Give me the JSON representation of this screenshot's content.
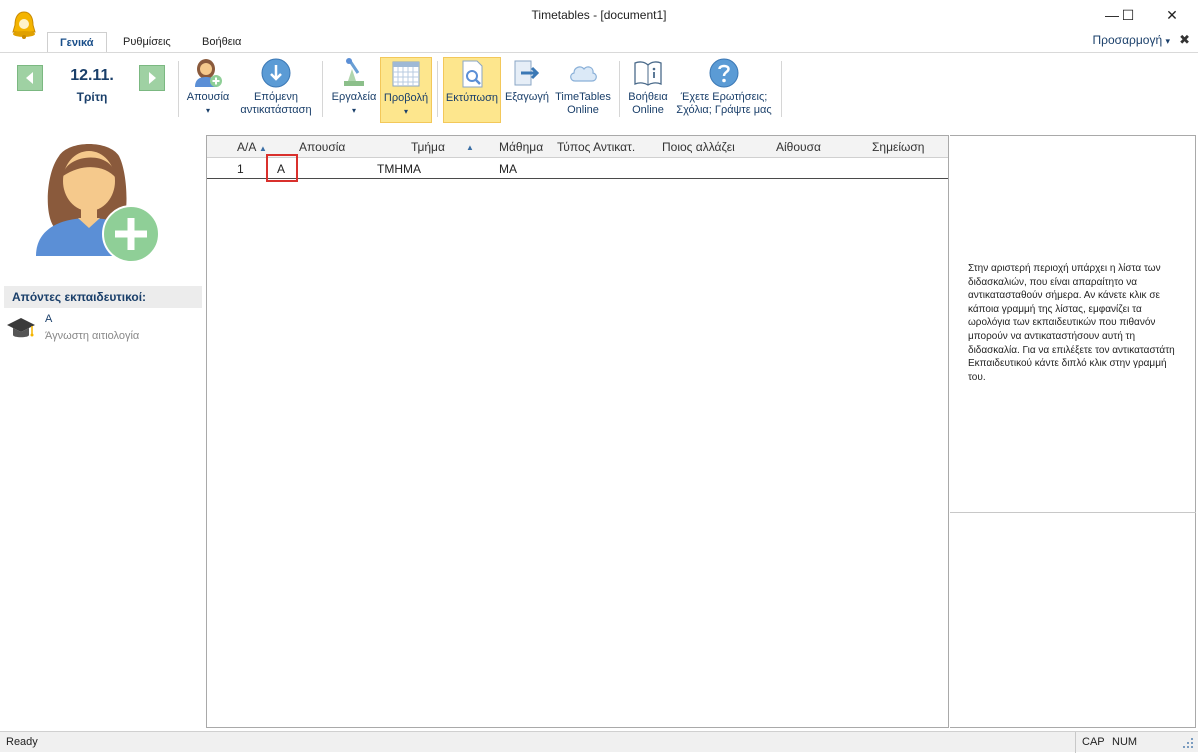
{
  "window": {
    "title": "Timetables - [document1]",
    "minimize": "—",
    "maximize": "☐",
    "close": "✕"
  },
  "tabs": [
    "Γενικά",
    "Ρυθμίσεις",
    "Βοήθεια"
  ],
  "customize": {
    "label": "Προσαρμογή",
    "arrow": "▾",
    "close": "✖"
  },
  "date": {
    "value": "12.11.",
    "day": "Τρίτη"
  },
  "ribbon": {
    "absence": "Απουσία",
    "next_line1": "Επόμενη",
    "next_line2": "αντικατάσταση",
    "tools": "Εργαλεία",
    "view": "Προβολή",
    "print": "Εκτύπωση",
    "export": "Εξαγωγή",
    "online_line1": "TimeTables",
    "online_line2": "Online",
    "help_line1": "Βοήθεια",
    "help_line2": "Online",
    "feedback_line1": "Έχετε Ερωτήσεις;",
    "feedback_line2": "Σχόλια; Γράψτε μας",
    "dropdown_arrow": "▾"
  },
  "left": {
    "header": "Απόντες εκπαιδευτικοί:",
    "absent_teachers": [
      {
        "name": "Α",
        "reason": "Άγνωστη αιτιολογία"
      }
    ]
  },
  "grid": {
    "columns": [
      "Α/Α",
      "Απουσία",
      "Τμήμα",
      "Μάθημα",
      "Τύπος Αντικατ.",
      "Ποιος αλλάζει",
      "Αίθουσα",
      "Σημείωση"
    ],
    "sort_icon": "▲",
    "rows": [
      {
        "aa": "1",
        "absence": "Α",
        "class": "ΤΜΗΜΑ",
        "lesson": "ΜΑ",
        "type": "",
        "who": "",
        "room": "",
        "note": ""
      }
    ]
  },
  "info": {
    "text": "Στην αριστερή περιοχή υπάρχει η λίστα των διδασκαλιών, που είναι απαραίτητο να αντικατασταθούν σήμερα. Αν κάνετε κλικ σε κάποια γραμμή της λίστας, εμφανίζει τα ωρολόγια των εκπαιδευτικών που πιθανόν μπορούν να αντικαταστήσουν αυτή τη διδασκαλία. Για να επιλέξετε τον αντικαταστάτη Εκπαιδευτικού κάντε διπλό κλικ στην γραμμή του."
  },
  "status": {
    "ready": "Ready",
    "cap": "CAP",
    "num": "NUM"
  },
  "colors": {
    "accent": "#1a3f6a",
    "highlight": "#fde68d",
    "marker": "#d9302c",
    "nav_green": "#9fd1a3"
  }
}
